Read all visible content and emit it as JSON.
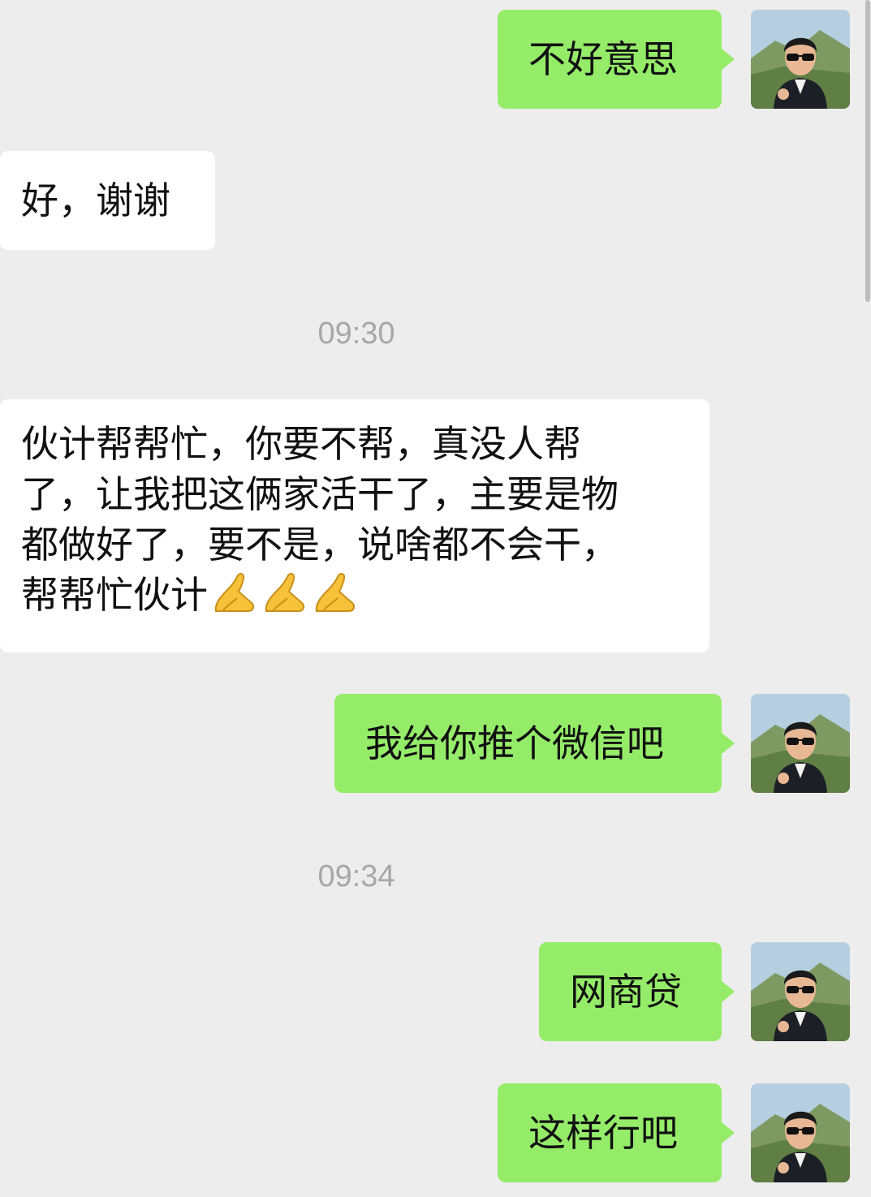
{
  "messages": [
    {
      "side": "out",
      "text": "不好意思"
    },
    {
      "side": "in",
      "text": "好，谢谢"
    },
    {
      "type": "time",
      "text": "09:30"
    },
    {
      "side": "in",
      "lines": [
        "伙计帮帮忙，你要不帮，真没人帮",
        "了，让我把这俩家活干了，主要是物",
        "都做好了，要不是，说啥都不会干，",
        "帮帮忙伙计"
      ],
      "emoji": "folded-hands-icon",
      "emoji_count": 3
    },
    {
      "side": "out",
      "text": "我给你推个微信吧"
    },
    {
      "type": "time",
      "text": "09:34"
    },
    {
      "side": "out",
      "text": "网商贷"
    },
    {
      "side": "out",
      "text": "这样行吧"
    }
  ],
  "colors": {
    "background": "#ededed",
    "outgoing_bubble": "#95ec69",
    "incoming_bubble": "#ffffff",
    "timestamp": "#a7a7a7"
  },
  "avatar_icon": "user-avatar-photo"
}
